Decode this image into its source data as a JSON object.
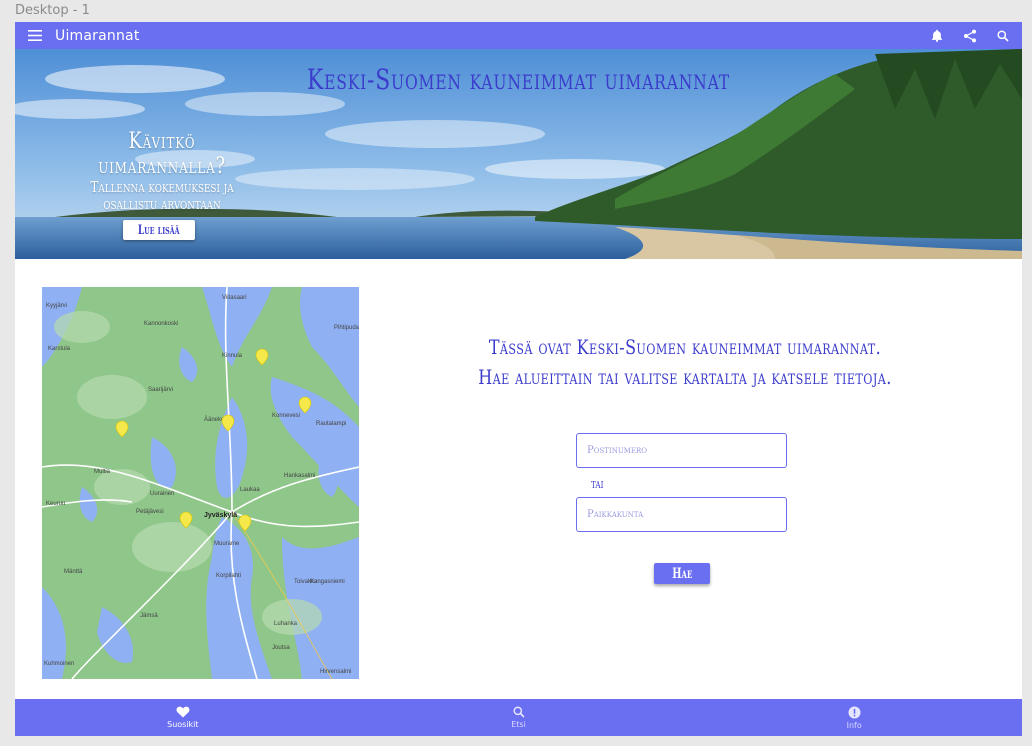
{
  "canvas": {
    "label": "Desktop - 1"
  },
  "appbar": {
    "title": "Uimarannat",
    "menu_icon": "menu-icon",
    "actions": [
      "bell-icon",
      "share-icon",
      "search-icon"
    ]
  },
  "hero": {
    "title": "Keski-Suomen kauneimmat uimarannat",
    "promo_heading": "Kävitkö uimarannalla?",
    "promo_text": "Tallenna kokemuksesi ja osallistu arvontaan",
    "read_more_label": "Lue lisää"
  },
  "map": {
    "places": [
      "Viitasaari",
      "Kyyjärvi",
      "Kannonkoski",
      "Karstula",
      "Pihtipudas",
      "Kinnula",
      "Saarijärvi",
      "Äänekoski",
      "Konnevesi",
      "Rautalampi",
      "Hankasalmi",
      "Laukaa",
      "Jyväskylä",
      "Uurainen",
      "Petäjävesi",
      "Keuruu",
      "Muurame",
      "Korpilahti",
      "Jämsä",
      "Toivakka",
      "Joutsa",
      "Multia",
      "Hirvensalmi",
      "Kangasniemi",
      "Luhanka",
      "Mänttä",
      "Kuhmoinen"
    ]
  },
  "main": {
    "intro_line1": "Tässä ovat Keski-Suomen kauneimmat uimarannat.",
    "intro_line2": "Hae alueittain tai valitse kartalta ja katsele tietoja.",
    "postal_placeholder": "Postinumero",
    "or_label": "tai",
    "city_placeholder": "Paikkakunta",
    "submit_label": "Hae"
  },
  "bottom_nav": [
    {
      "label": "Suosikit",
      "icon": "heart-icon",
      "active": true
    },
    {
      "label": "Etsi",
      "icon": "search-icon",
      "active": false
    },
    {
      "label": "Info",
      "icon": "info-icon",
      "active": false
    }
  ],
  "colors": {
    "primary": "#6a6ef0",
    "accent_text": "#3b3ccc",
    "marker": "#f5e84a",
    "map_land": "#8fc68a",
    "map_water": "#8fb0f2"
  }
}
